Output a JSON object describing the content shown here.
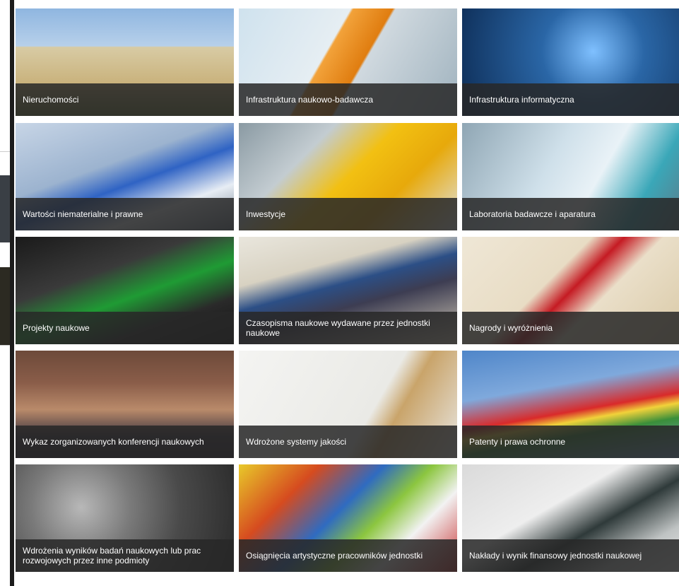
{
  "tiles": [
    {
      "label": "Nieruchomości",
      "scene": "sky-build"
    },
    {
      "label": "Infrastruktura naukowo-badawcza",
      "scene": "robot"
    },
    {
      "label": "Infrastruktura informatyczna",
      "scene": "it"
    },
    {
      "label": "Wartości niematerialne i prawne",
      "scene": "keys-blue"
    },
    {
      "label": "Inwestycje",
      "scene": "helmet"
    },
    {
      "label": "Laboratoria badawcze i aparatura",
      "scene": "lab"
    },
    {
      "label": "Projekty naukowe",
      "scene": "know"
    },
    {
      "label": "Czasopisma naukowe wydawane przez jednostki naukowe",
      "scene": "journals"
    },
    {
      "label": "Nagrody i wyróżnienia",
      "scene": "diploma"
    },
    {
      "label": "Wykaz zorganizowanych konferencji naukowych",
      "scene": "conf"
    },
    {
      "label": "Wdrożone systemy jakości",
      "scene": "sign"
    },
    {
      "label": "Patenty i prawa ochronne",
      "scene": "flags"
    },
    {
      "label": "Wdrożenia wyników badań naukowych lub prac rozwojowych przez inne podmioty",
      "scene": "gears"
    },
    {
      "label": "Osiągnięcia artystyczne pracowników jednostki",
      "scene": "paint"
    },
    {
      "label": "Nakłady i wynik finansowy jednostki naukowej",
      "scene": "calc"
    }
  ]
}
